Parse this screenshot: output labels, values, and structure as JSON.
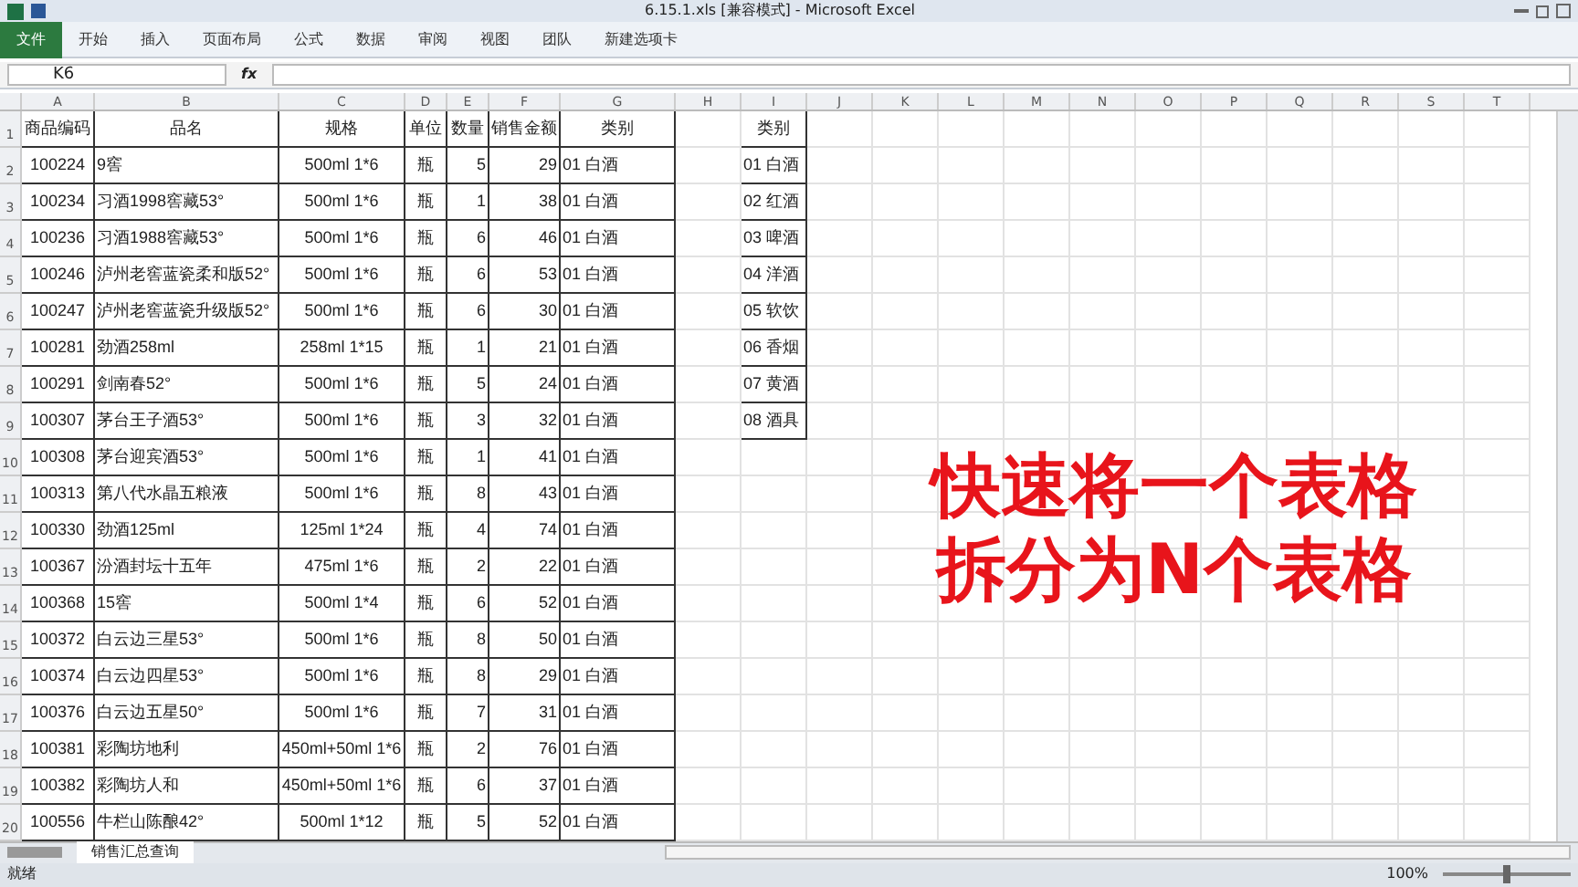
{
  "window": {
    "title": "6.15.1.xls  [兼容模式]  -  Microsoft Excel"
  },
  "ribbon_tabs": [
    {
      "label": "文件",
      "selected": true
    },
    {
      "label": "开始",
      "selected": false
    },
    {
      "label": "插入",
      "selected": false
    },
    {
      "label": "页面布局",
      "selected": false
    },
    {
      "label": "公式",
      "selected": false
    },
    {
      "label": "数据",
      "selected": false
    },
    {
      "label": "审阅",
      "selected": false
    },
    {
      "label": "视图",
      "selected": false
    },
    {
      "label": "团队",
      "selected": false
    },
    {
      "label": "新建选项卡",
      "selected": false
    }
  ],
  "formula_bar": {
    "name_box": "K6",
    "fx": "fx"
  },
  "columns": [
    "A",
    "B",
    "C",
    "D",
    "E",
    "F",
    "G",
    "H",
    "I",
    "J",
    "K",
    "L",
    "M",
    "N",
    "O",
    "P",
    "Q",
    "R",
    "S",
    "T"
  ],
  "row_numbers": [
    "1",
    "2",
    "3",
    "4",
    "5",
    "6",
    "7",
    "8",
    "9",
    "10",
    "11",
    "12",
    "13",
    "14",
    "15",
    "16",
    "17",
    "18",
    "19",
    "20"
  ],
  "table": {
    "columns": [
      "商品编码",
      "品名",
      "规格",
      "单位",
      "数量",
      "销售金额",
      "类别"
    ],
    "rows": [
      [
        "100224",
        "9窖",
        "500ml 1*6",
        "瓶",
        "5",
        "29",
        "01 白酒"
      ],
      [
        "100234",
        "习酒1998窖藏53°",
        "500ml 1*6",
        "瓶",
        "1",
        "38",
        "01 白酒"
      ],
      [
        "100236",
        "习酒1988窖藏53°",
        "500ml 1*6",
        "瓶",
        "6",
        "46",
        "01 白酒"
      ],
      [
        "100246",
        "泸州老窖蓝瓷柔和版52°",
        "500ml 1*6",
        "瓶",
        "6",
        "53",
        "01 白酒"
      ],
      [
        "100247",
        "泸州老窖蓝瓷升级版52°",
        "500ml 1*6",
        "瓶",
        "6",
        "30",
        "01 白酒"
      ],
      [
        "100281",
        "劲酒258ml",
        "258ml 1*15",
        "瓶",
        "1",
        "21",
        "01 白酒"
      ],
      [
        "100291",
        "剑南春52°",
        "500ml 1*6",
        "瓶",
        "5",
        "24",
        "01 白酒"
      ],
      [
        "100307",
        "茅台王子酒53°",
        "500ml 1*6",
        "瓶",
        "3",
        "32",
        "01 白酒"
      ],
      [
        "100308",
        "茅台迎宾酒53°",
        "500ml 1*6",
        "瓶",
        "1",
        "41",
        "01 白酒"
      ],
      [
        "100313",
        "第八代水晶五粮液",
        "500ml 1*6",
        "瓶",
        "8",
        "43",
        "01 白酒"
      ],
      [
        "100330",
        "劲酒125ml",
        "125ml 1*24",
        "瓶",
        "4",
        "74",
        "01 白酒"
      ],
      [
        "100367",
        "汾酒封坛十五年",
        "475ml 1*6",
        "瓶",
        "2",
        "22",
        "01 白酒"
      ],
      [
        "100368",
        "15窖",
        "500ml 1*4",
        "瓶",
        "6",
        "52",
        "01 白酒"
      ],
      [
        "100372",
        "白云边三星53°",
        "500ml 1*6",
        "瓶",
        "8",
        "50",
        "01 白酒"
      ],
      [
        "100374",
        "白云边四星53°",
        "500ml 1*6",
        "瓶",
        "8",
        "29",
        "01 白酒"
      ],
      [
        "100376",
        "白云边五星50°",
        "500ml 1*6",
        "瓶",
        "7",
        "31",
        "01 白酒"
      ],
      [
        "100381",
        "彩陶坊地利",
        "450ml+50ml 1*6",
        "瓶",
        "2",
        "76",
        "01 白酒"
      ],
      [
        "100382",
        "彩陶坊人和",
        "450ml+50ml 1*6",
        "瓶",
        "6",
        "37",
        "01 白酒"
      ],
      [
        "100556",
        "牛栏山陈酿42°",
        "500ml 1*12",
        "瓶",
        "5",
        "52",
        "01 白酒"
      ]
    ]
  },
  "category_table": {
    "header": "类别",
    "items": [
      "01 白酒",
      "02 红酒",
      "03 啤酒",
      "04 洋酒",
      "05 软饮",
      "06 香烟",
      "07 黄酒",
      "08 酒具"
    ]
  },
  "overlay_text": [
    "快速将一个表格",
    "拆分为N个表格"
  ],
  "sheet_tabs": [
    {
      "label": "销售汇总查询",
      "selected": true
    }
  ],
  "status_bar": {
    "status": "就绪",
    "zoom": "100%",
    "zoom_slider": {
      "level": 0.5
    }
  }
}
